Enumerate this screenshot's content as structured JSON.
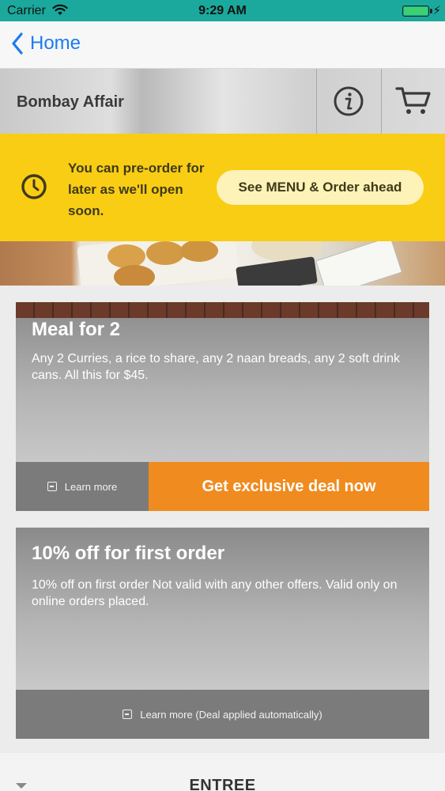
{
  "status_bar": {
    "carrier": "Carrier",
    "time": "9:29 AM",
    "battery_color": "#3bd16f",
    "icons": [
      "wifi-icon",
      "battery-icon",
      "charging-bolt-icon"
    ]
  },
  "nav": {
    "back_label": "Home",
    "accent_color": "#1a7cf0"
  },
  "restaurant": {
    "name": "Bombay Affair",
    "icons": [
      "info-icon",
      "cart-icon"
    ]
  },
  "banner": {
    "message": "You can pre-order for later as we'll open soon.",
    "cta_label": "See MENU & Order ahead",
    "icon": "clock-icon",
    "background_color": "#f9cd14"
  },
  "deals": [
    {
      "title": "Meal for 2",
      "description": "Any 2 Curries, a rice to share, any 2 naan breads, any 2 soft drink cans. All this for $45.",
      "learn_more_label": "Learn more",
      "deal_button_label": "Get exclusive deal now",
      "deal_button_color": "#ef8b1f"
    },
    {
      "title": "10% off for first order",
      "description": "10% off on first order Not valid with any other offers. Valid only on online orders placed.",
      "learn_more_label": "Learn more (Deal applied automatically)"
    }
  ],
  "menu_section": {
    "label": "ENTREE",
    "icon": "chevron-down-icon"
  }
}
